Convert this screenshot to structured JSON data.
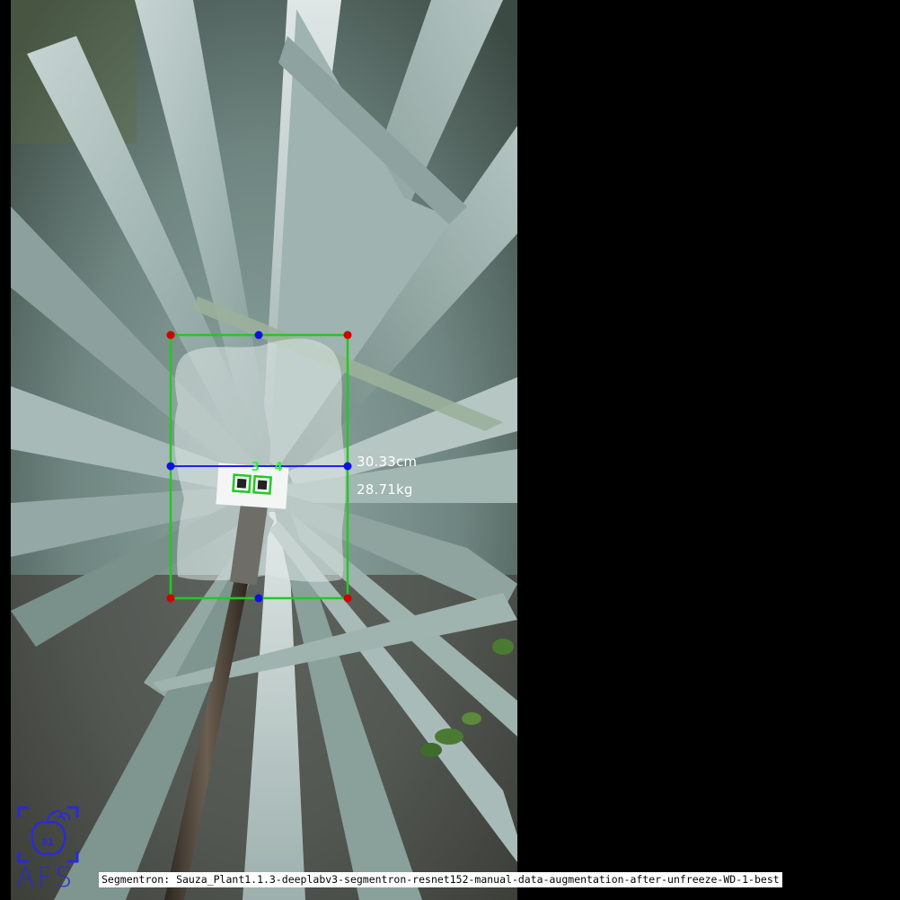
{
  "measurements": {
    "width_label": "30.33cm",
    "weight_label": "28.71kg"
  },
  "markers": {
    "ids_label": "3 4"
  },
  "caption": {
    "text": "Segmentron: Sauza_Plant1.1.3-deeplabv3-segmentron-resnet152-manual-data-augmentation-after-unfreeze-WD-1-best"
  },
  "logo": {
    "text": "AFS",
    "color": "#2a2ad8"
  },
  "colors": {
    "bbox": "#22c922",
    "corner_points": "#d00000",
    "midpoints": "#1010e0",
    "width_line": "#2020ff",
    "mask": "#d8e4e0"
  }
}
